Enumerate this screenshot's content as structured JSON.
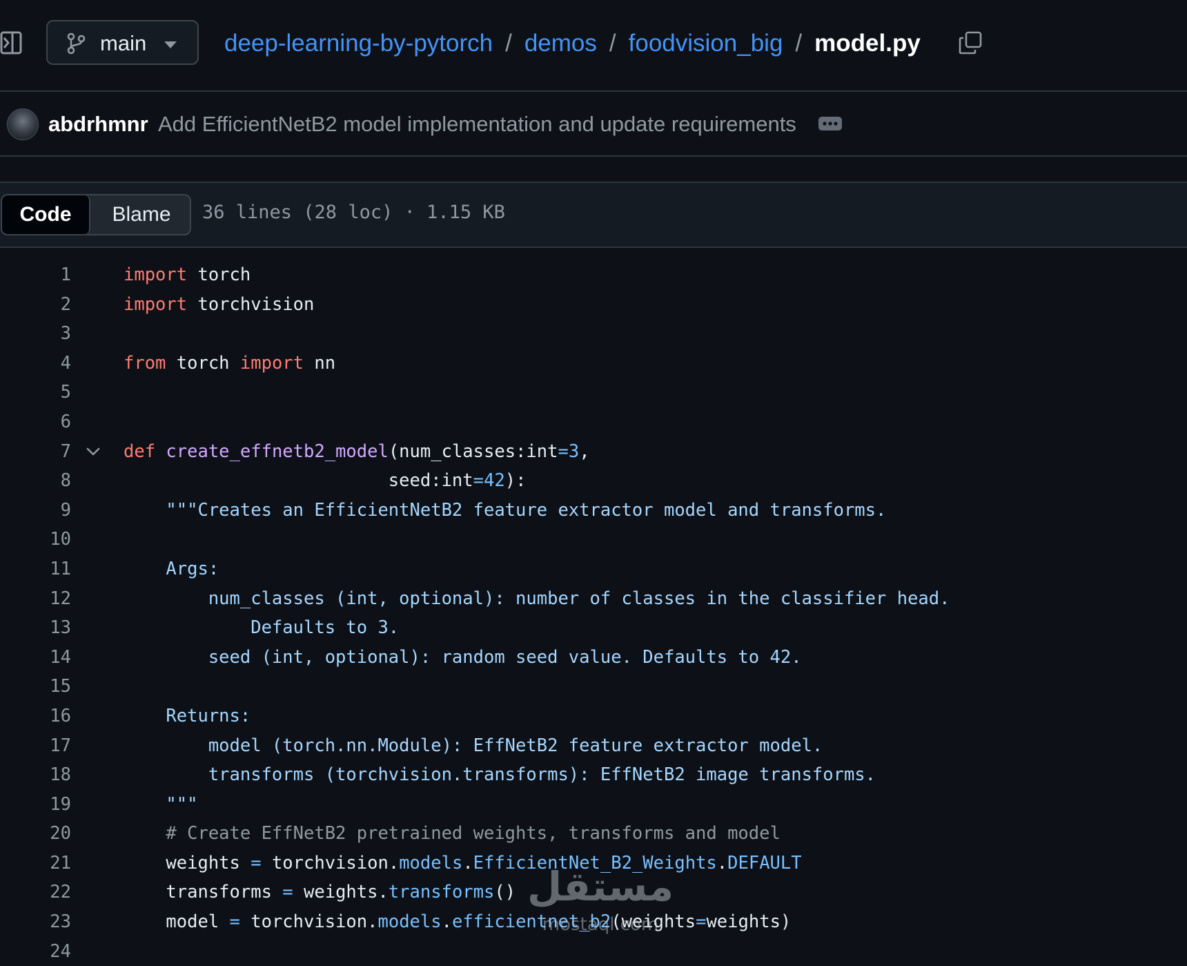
{
  "header": {
    "branch": "main",
    "breadcrumb": [
      "deep-learning-by-pytorch",
      "demos",
      "foodvision_big"
    ],
    "separator": "/",
    "file_name": "model.py"
  },
  "commit": {
    "author": "abdrhmnr",
    "message": "Add EfficientNetB2 model implementation and update requirements"
  },
  "file_bar": {
    "tabs": [
      "Code",
      "Blame"
    ],
    "active_tab": "Code",
    "meta": "36 lines (28 loc) · 1.15 KB"
  },
  "code_lines": [
    [
      [
        "kw",
        "import"
      ],
      [
        "",
        " torch"
      ]
    ],
    [
      [
        "kw",
        "import"
      ],
      [
        "",
        " torchvision"
      ]
    ],
    [],
    [
      [
        "kw",
        "from"
      ],
      [
        "",
        " torch "
      ],
      [
        "kw",
        "import"
      ],
      [
        "",
        " nn"
      ]
    ],
    [],
    [],
    [
      [
        "kw",
        "def"
      ],
      [
        "",
        " "
      ],
      [
        "fn",
        "create_effnetb2_model"
      ],
      [
        "",
        "(num_classes:int"
      ],
      [
        "op",
        "="
      ],
      [
        "num",
        "3"
      ],
      [
        "",
        ","
      ]
    ],
    [
      [
        "",
        "                         seed:int"
      ],
      [
        "op",
        "="
      ],
      [
        "num",
        "42"
      ],
      [
        "",
        "):"
      ]
    ],
    [
      [
        "str",
        "    \"\"\"Creates an EfficientNetB2 feature extractor model and transforms."
      ]
    ],
    [],
    [
      [
        "str",
        "    Args:"
      ]
    ],
    [
      [
        "str",
        "        num_classes (int, optional): number of classes in the classifier head."
      ]
    ],
    [
      [
        "str",
        "            Defaults to 3."
      ]
    ],
    [
      [
        "str",
        "        seed (int, optional): random seed value. Defaults to 42."
      ]
    ],
    [],
    [
      [
        "str",
        "    Returns:"
      ]
    ],
    [
      [
        "str",
        "        model (torch.nn.Module): EffNetB2 feature extractor model."
      ]
    ],
    [
      [
        "str",
        "        transforms (torchvision.transforms): EffNetB2 image transforms."
      ]
    ],
    [
      [
        "str",
        "    \"\"\""
      ]
    ],
    [
      [
        "cm",
        "    # Create EffNetB2 pretrained weights, transforms and model"
      ]
    ],
    [
      [
        "",
        "    weights "
      ],
      [
        "op",
        "="
      ],
      [
        "",
        " torchvision."
      ],
      [
        "at",
        "models"
      ],
      [
        "",
        "."
      ],
      [
        "at",
        "EfficientNet_B2_Weights"
      ],
      [
        "",
        "."
      ],
      [
        "at",
        "DEFAULT"
      ]
    ],
    [
      [
        "",
        "    transforms "
      ],
      [
        "op",
        "="
      ],
      [
        "",
        " weights."
      ],
      [
        "at",
        "transforms"
      ],
      [
        "",
        "()"
      ]
    ],
    [
      [
        "",
        "    model "
      ],
      [
        "op",
        "="
      ],
      [
        "",
        " torchvision."
      ],
      [
        "at",
        "models"
      ],
      [
        "",
        "."
      ],
      [
        "at",
        "efficientnet_b2"
      ],
      [
        "",
        "(weights"
      ],
      [
        "op",
        "="
      ],
      [
        "",
        "weights)"
      ]
    ],
    []
  ],
  "foldable_lines": [
    7
  ],
  "watermark": {
    "arabic": "مستقل",
    "latin": "mostaql.com"
  },
  "colors": {
    "background": "#0d1117",
    "link": "#4493f8",
    "keyword": "#ff7b72",
    "function": "#d2a8ff",
    "constant": "#79c0ff",
    "string": "#a5d6ff",
    "comment": "#9198a1"
  },
  "icons": [
    "sidebar-toggle-icon",
    "git-branch-icon",
    "caret-down-icon",
    "copy-icon",
    "ellipsis-icon",
    "chevron-down-icon"
  ]
}
